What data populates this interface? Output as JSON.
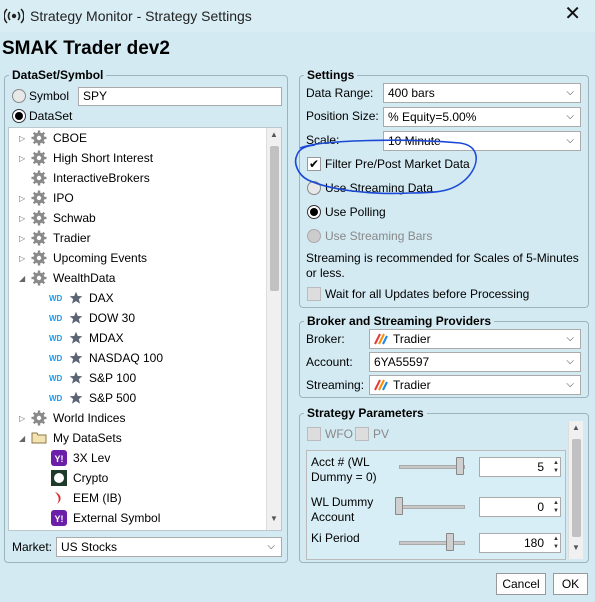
{
  "window": {
    "title": "Strategy Monitor - Strategy Settings",
    "close": "✕"
  },
  "header": {
    "title": "SMAK Trader dev2"
  },
  "dataset": {
    "legend": "DataSet/Symbol",
    "symbol_label": "Symbol",
    "symbol_value": "SPY",
    "dataset_label": "DataSet",
    "tree": [
      {
        "label": "CBOE",
        "icon": "gear-icon",
        "expander": "▷"
      },
      {
        "label": "High Short Interest",
        "icon": "gear-icon",
        "expander": "▷"
      },
      {
        "label": "InteractiveBrokers",
        "icon": "gear-icon",
        "expander": ""
      },
      {
        "label": "IPO",
        "icon": "gear-icon",
        "expander": "▷"
      },
      {
        "label": "Schwab",
        "icon": "gear-icon",
        "expander": "▷"
      },
      {
        "label": "Tradier",
        "icon": "gear-icon",
        "expander": "▷"
      },
      {
        "label": "Upcoming Events",
        "icon": "gear-icon",
        "expander": "▷"
      },
      {
        "label": "WealthData",
        "icon": "gear-icon",
        "expander": "◢"
      },
      {
        "label": "DAX",
        "icon": "star-icon",
        "badge": "WD"
      },
      {
        "label": "DOW 30",
        "icon": "star-icon",
        "badge": "WD"
      },
      {
        "label": "MDAX",
        "icon": "star-icon",
        "badge": "WD"
      },
      {
        "label": "NASDAQ 100",
        "icon": "star-icon",
        "badge": "WD"
      },
      {
        "label": "S&P 100",
        "icon": "star-icon",
        "badge": "WD"
      },
      {
        "label": "S&P 500",
        "icon": "star-icon",
        "badge": "WD"
      },
      {
        "label": "World Indices",
        "icon": "gear-icon",
        "expander": "▷"
      },
      {
        "label": "My DataSets",
        "icon": "folder-icon",
        "expander": "◢"
      },
      {
        "label": "3X Lev",
        "icon": "yahoo-icon",
        "badge": "Y!"
      },
      {
        "label": "Crypto",
        "icon": "coin-icon",
        "badge": ""
      },
      {
        "label": "EEM (IB)",
        "icon": "ib-icon",
        "badge": ""
      },
      {
        "label": "External Symbol",
        "icon": "yahoo-icon",
        "badge": "Y!"
      }
    ],
    "market_label": "Market:",
    "market_value": "US Stocks"
  },
  "settings": {
    "legend": "Settings",
    "data_range_label": "Data Range:",
    "data_range_value": "400 bars",
    "position_size_label": "Position Size:",
    "position_size_value": "% Equity=5.00%",
    "scale_label": "Scale:",
    "scale_value": "10 Minute",
    "filter_label": "Filter Pre/Post Market Data",
    "streaming_data_label": "Use Streaming Data",
    "polling_label": "Use Polling",
    "streaming_bars_label": "Use Streaming Bars",
    "note": "Streaming is recommended for Scales of 5-Minutes or less.",
    "wait_label": "Wait for all Updates before Processing"
  },
  "broker": {
    "legend": "Broker and Streaming Providers",
    "broker_label": "Broker:",
    "broker_value": "Tradier",
    "account_label": "Account:",
    "account_value": "6YA55597",
    "streaming_label": "Streaming:",
    "streaming_value": "Tradier"
  },
  "params": {
    "legend": "Strategy Parameters",
    "wfo_label": "WFO",
    "pv_label": "PV",
    "items": [
      {
        "label": "Acct # (WL Dummy = 0)",
        "value": "5",
        "level": 0.95
      },
      {
        "label": "WL Dummy Account",
        "value": "0",
        "level": 0.0
      },
      {
        "label": "Ki Period",
        "value": "180",
        "level": 0.8
      }
    ]
  },
  "buttons": {
    "cancel": "Cancel",
    "ok": "OK"
  },
  "colors": {
    "annotation": "#1b49d6",
    "accent_blue": "#1e9be6",
    "background": "#d3eaf2"
  }
}
